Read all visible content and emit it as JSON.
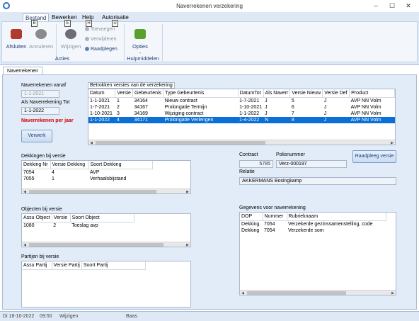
{
  "window": {
    "title": "Naverrekenen verzekering",
    "minimize": "–",
    "maximize": "☐",
    "close": "✕"
  },
  "ribbon": {
    "tabs": [
      {
        "label": "Bestand",
        "keytip": "B"
      },
      {
        "label": "Bewerken",
        "keytip": "E"
      },
      {
        "label": "Help",
        "keytip": "H"
      },
      {
        "label": "Autorisatie",
        "keytip": "U"
      }
    ],
    "buttons": {
      "afsluiten": "Afsluiten",
      "annuleren": "Annuleren",
      "wijzigen": "Wijzigen",
      "toevoegen": "Toevoegen",
      "verwijderen": "Verwijderen",
      "raadplegen": "Raadplegen",
      "opties": "Opties",
      "opties_sub": "-"
    },
    "groups": {
      "acties": "Acties",
      "hulpmiddelen": "Hulpmiddelen"
    },
    "colors": {
      "afsluiten": "#b03a2e",
      "annuleren": "#7a7a7a",
      "wijzigen": "#6d6d7a",
      "opties": "#5aa02c"
    }
  },
  "doc_tab": "Naverrekenen",
  "form": {
    "vanaf_label": "Naverrekenen vanaf",
    "vanaf_value": "1-1-2021",
    "tot_label": "Als Naverrekening Tot",
    "tot_value": "1-1-2022",
    "per_jaar": "Naverrekenen per jaar",
    "verwerk": "Verwerk",
    "contract_label": "Contract",
    "contract_value": "5785",
    "polis_label": "Polisnummer",
    "polis_value": "Verz-000197",
    "relatie_label": "Relatie",
    "relatie_value": "AKKERMANS Bosingkamp",
    "raadpleeg_versie": "Raadpleeg versie"
  },
  "versies": {
    "title": "Betrokken versies van de verzekering",
    "columns": [
      "Datum",
      "Versie",
      "Gebeurtenis",
      "Type Gebeurtenis",
      "DatumTot",
      "Als Naverr",
      "Versie Nieuw",
      "Versie Def",
      "Product"
    ],
    "rows": [
      [
        "1-1-2021",
        "1",
        "34164",
        "Nieuw contract",
        "1-7-2021",
        "J",
        "5",
        "J",
        "AVP NN Volm"
      ],
      [
        "1-7-2021",
        "2",
        "34167",
        "Prolongatie Termijn",
        "1-10-2021",
        "J",
        "6",
        "J",
        "AVP NN Volm"
      ],
      [
        "1-10-2021",
        "3",
        "34169",
        "Wijziging contract",
        "1-1-2022",
        "J",
        "7",
        "J",
        "AVP NN Volm"
      ],
      [
        "1-1-2022",
        "4",
        "34171",
        "Prolongatie Verlengen",
        "1-4-2022",
        "N",
        "8",
        "J",
        "AVP NN Volm"
      ]
    ],
    "selected_index": 3
  },
  "dekkingen": {
    "title": "Dekkingen bij versie",
    "columns": [
      "Dekking Nr",
      "Versie Dekking",
      "Soort Dekking"
    ],
    "rows": [
      [
        "7054",
        "4",
        "AVP"
      ],
      [
        "7055",
        "1",
        "Verhaalsbijstand"
      ]
    ]
  },
  "objecten": {
    "title": "Objecten bij versie",
    "columns": [
      "Assu Object",
      "Versie",
      "Soort Object"
    ],
    "rows": [
      [
        "1080",
        "2",
        "Toeslag avp"
      ]
    ]
  },
  "partijen": {
    "title": "Partijen bij versie",
    "columns": [
      "Assu Partij",
      "Versie Partij",
      "Soort Partij"
    ],
    "rows": []
  },
  "gegevens": {
    "title": "Gegevens voor naverrekening",
    "columns": [
      "DOP",
      "Nummer",
      "Rubrieknaam"
    ],
    "rows": [
      [
        "Dekking",
        "7054",
        "Verzekerde gezinssamenstelling, code"
      ],
      [
        "Dekking",
        "7054",
        "Verzekerde som"
      ]
    ]
  },
  "status": {
    "date": "Di 18-10-2022",
    "time": "09:50",
    "mode": "Wijzigen",
    "user": "Baas"
  }
}
